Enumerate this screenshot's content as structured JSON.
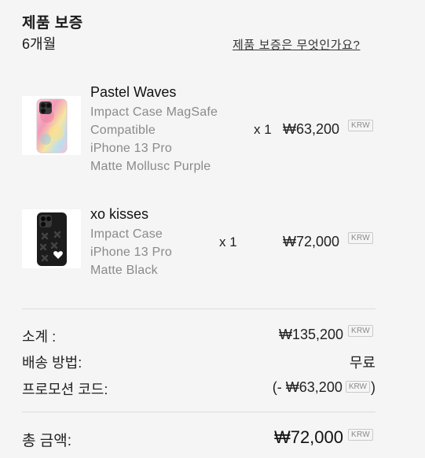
{
  "warranty": {
    "title": "제품 보증",
    "period": "6개월",
    "link": "제품 보증은 무엇인가요?"
  },
  "currency_badge": "KRW",
  "items": [
    {
      "name": "Pastel Waves",
      "lines": [
        "Impact Case MagSafe",
        "Compatible",
        "iPhone 13 Pro",
        "Matte Mollusc Purple"
      ],
      "qty": "x 1",
      "price": "₩63,200"
    },
    {
      "name": "xo kisses",
      "lines": [
        "Impact Case",
        "iPhone 13 Pro",
        "Matte Black"
      ],
      "qty": "x 1",
      "price": "₩72,000"
    }
  ],
  "summary": {
    "subtotal_label": "소계 :",
    "subtotal_value": "₩135,200",
    "shipping_label": "배송 방법:",
    "shipping_value": "무료",
    "promo_label": "프로모션 코드:",
    "promo_prefix": "(- ",
    "promo_value": "₩63,200",
    "promo_suffix": ")",
    "total_label": "총 금액:",
    "total_value": "₩72,000"
  },
  "colors": {
    "background": "#f5f5f5",
    "text": "#1a1a1a",
    "muted": "#8a8a8a"
  }
}
